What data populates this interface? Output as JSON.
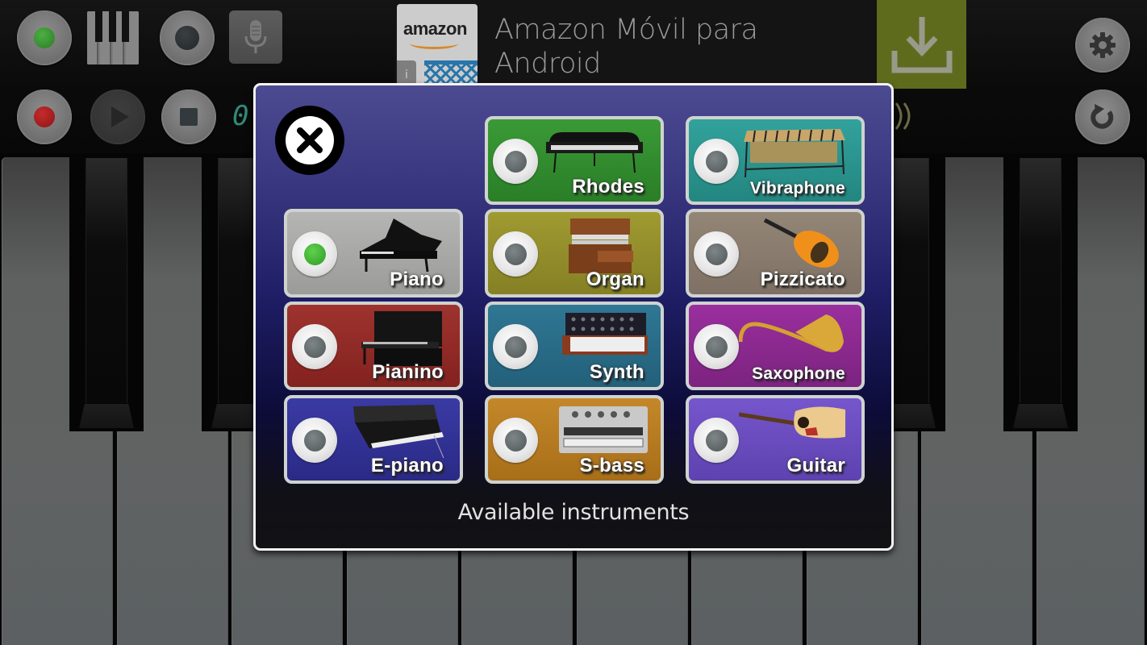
{
  "app": {
    "name": "Piano"
  },
  "toolbar": {
    "top_row": [
      {
        "id": "instrument-led",
        "icon": "green-led-icon"
      },
      {
        "id": "keyboard-layout",
        "icon": "piano-keys-icon"
      },
      {
        "id": "mode",
        "icon": "dark-dot-icon"
      },
      {
        "id": "microphone",
        "icon": "microphone-icon"
      }
    ],
    "bottom_row": [
      {
        "id": "record",
        "icon": "record-icon"
      },
      {
        "id": "play",
        "icon": "play-icon"
      },
      {
        "id": "stop",
        "icon": "stop-icon"
      }
    ],
    "lcd_display": "0",
    "right_buttons": [
      {
        "id": "settings",
        "icon": "gear-icon"
      },
      {
        "id": "reset",
        "icon": "refresh-icon"
      }
    ]
  },
  "ad": {
    "logo_text": "amazon",
    "info_badge": "i",
    "title": "Amazon Móvil para Android",
    "cta_icon": "download-icon",
    "colors": {
      "cta": "#5e6b1d"
    }
  },
  "keyboard": {
    "white_key_count": 10,
    "black_keys_visible": 4
  },
  "dialog": {
    "title": "Available instruments",
    "close_icon": "close-icon",
    "selected": "Piano",
    "instruments": [
      {
        "name": "Rhodes",
        "selected": false,
        "color": "#2f8a2c"
      },
      {
        "name": "Vibraphone",
        "selected": false,
        "color": "#2a8a86"
      },
      {
        "name": "Piano",
        "selected": true,
        "color": "#a7a7a5"
      },
      {
        "name": "Organ",
        "selected": false,
        "color": "#8c8a2a"
      },
      {
        "name": "Pizzicato",
        "selected": false,
        "color": "#8a7c6e"
      },
      {
        "name": "Pianino",
        "selected": false,
        "color": "#8f2a26"
      },
      {
        "name": "Synth",
        "selected": false,
        "color": "#2a6a84"
      },
      {
        "name": "Saxophone",
        "selected": false,
        "color": "#86288a"
      },
      {
        "name": "E-piano",
        "selected": false,
        "color": "#2f2f94"
      },
      {
        "name": "S-bass",
        "selected": false,
        "color": "#b77a1e"
      },
      {
        "name": "Guitar",
        "selected": false,
        "color": "#6a4cc0"
      }
    ]
  }
}
